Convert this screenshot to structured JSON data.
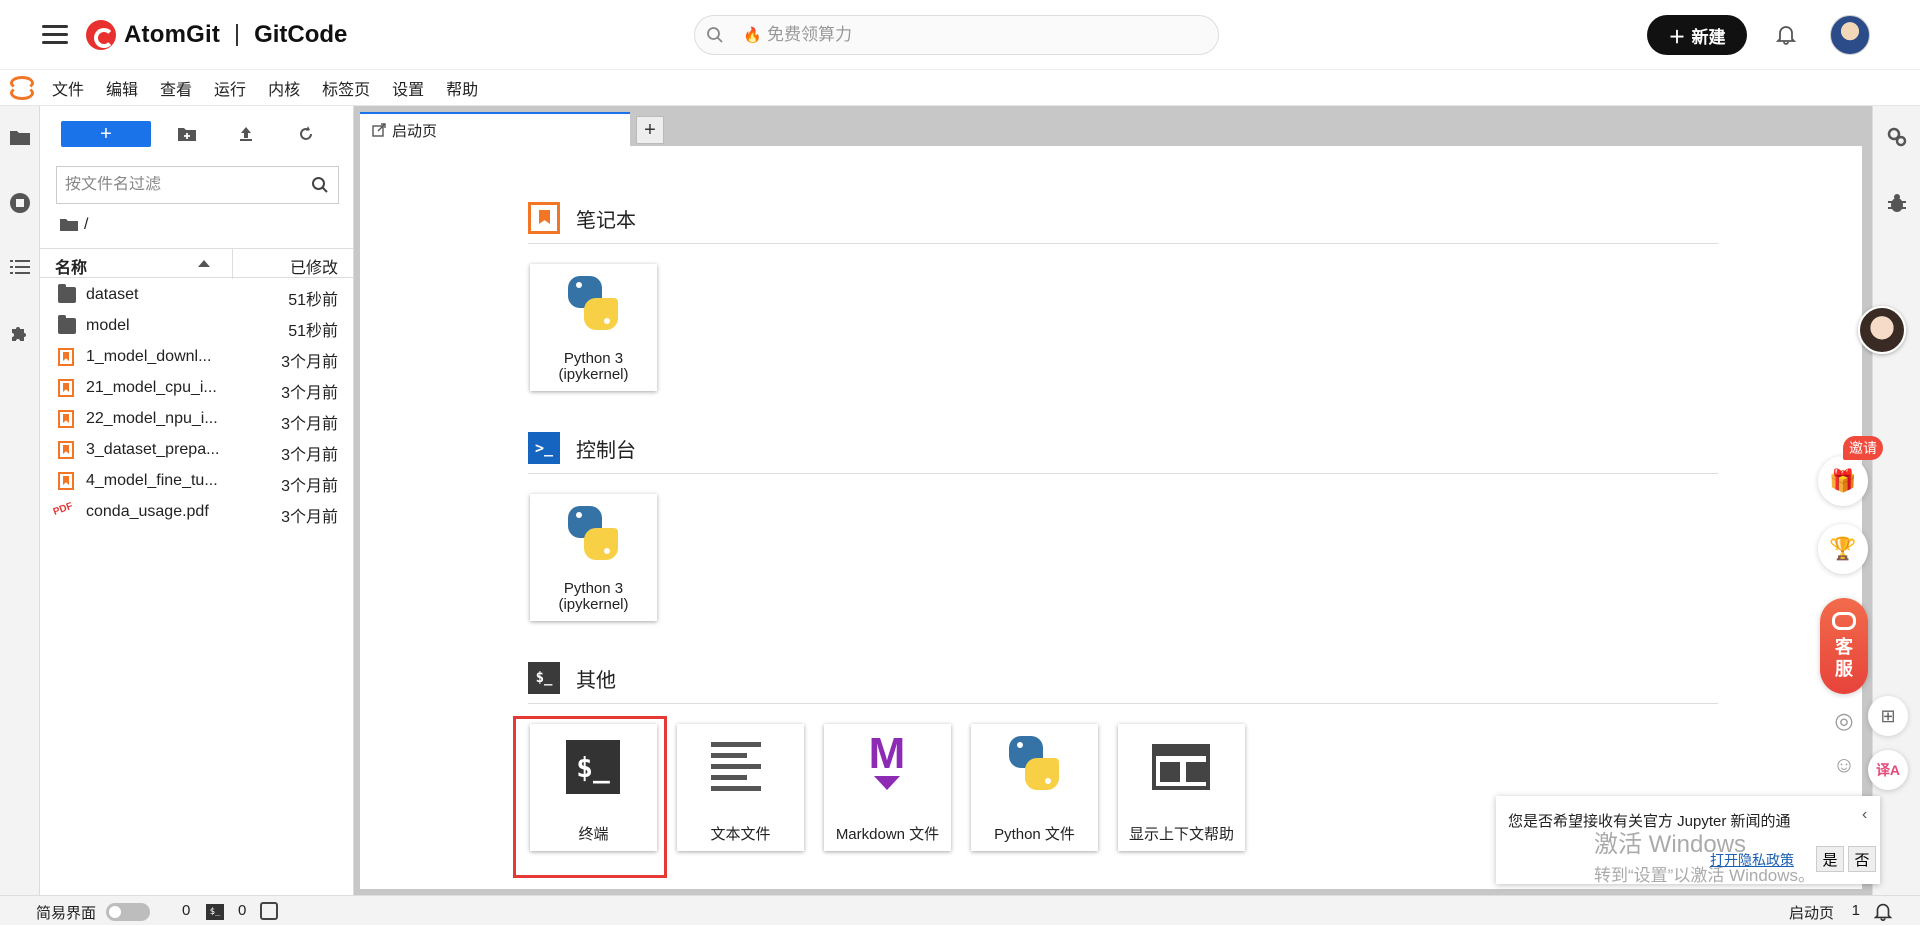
{
  "header": {
    "brand_primary": "AtomGit",
    "brand_secondary": "GitCode",
    "search_placeholder": "免费领算力",
    "new_button": "新建",
    "colors": {
      "brand_red": "#e8312f",
      "new_bg": "#111111"
    }
  },
  "menubar": {
    "items": [
      "文件",
      "编辑",
      "查看",
      "运行",
      "内核",
      "标签页",
      "设置",
      "帮助"
    ]
  },
  "filebrowser": {
    "new_button": "+",
    "filter_placeholder": "按文件名过滤",
    "path": "/",
    "columns": {
      "name": "名称",
      "modified": "已修改"
    },
    "files": [
      {
        "name": "dataset",
        "modified": "51秒前",
        "type": "folder"
      },
      {
        "name": "model",
        "modified": "51秒前",
        "type": "folder"
      },
      {
        "name": "1_model_downl...",
        "modified": "3个月前",
        "type": "notebook"
      },
      {
        "name": "21_model_cpu_i...",
        "modified": "3个月前",
        "type": "notebook"
      },
      {
        "name": "22_model_npu_i...",
        "modified": "3个月前",
        "type": "notebook"
      },
      {
        "name": "3_dataset_prepa...",
        "modified": "3个月前",
        "type": "notebook"
      },
      {
        "name": "4_model_fine_tu...",
        "modified": "3个月前",
        "type": "notebook"
      },
      {
        "name": "conda_usage.pdf",
        "modified": "3个月前",
        "type": "pdf"
      }
    ]
  },
  "tabs": {
    "launcher_label": "启动页",
    "add_label": "+"
  },
  "launcher": {
    "notebook": {
      "title": "笔记本",
      "cards": [
        {
          "line1": "Python 3",
          "line2": "(ipykernel)"
        }
      ]
    },
    "console": {
      "title": "控制台",
      "icon_text": ">_",
      "cards": [
        {
          "line1": "Python 3",
          "line2": "(ipykernel)"
        }
      ]
    },
    "other": {
      "title": "其他",
      "icon_text": "$_",
      "cards": [
        {
          "label": "终端",
          "icon": "terminal-icon",
          "icon_text": "$_"
        },
        {
          "label": "文本文件",
          "icon": "text-file-icon"
        },
        {
          "label": "Markdown 文件",
          "icon": "markdown-icon",
          "icon_text": "M"
        },
        {
          "label": "Python 文件",
          "icon": "python-icon"
        },
        {
          "label": "显示上下文帮助",
          "icon": "context-help-icon"
        }
      ]
    },
    "colors": {
      "notebook_orange": "#f37626",
      "console_blue": "#1565c0",
      "highlight_red": "#e53935"
    }
  },
  "floating": {
    "invite": "邀请",
    "kefu_line1": "客",
    "kefu_line2": "服",
    "translate": "译A"
  },
  "notification": {
    "message": "您是否希望接收有关官方 Jupyter 新闻的通",
    "privacy_link": "打开隐私政策",
    "yes": "是",
    "no": "否",
    "collapse": "‹"
  },
  "watermark": {
    "line1": "激活 Windows",
    "line2": "转到“设置”以激活 Windows。"
  },
  "statusbar": {
    "simple_mode_label": "简易界面",
    "kernel_count": "0",
    "terminal_count": "0",
    "terminal_icon_text": "$_",
    "active_tab": "启动页",
    "active_count": "1"
  }
}
